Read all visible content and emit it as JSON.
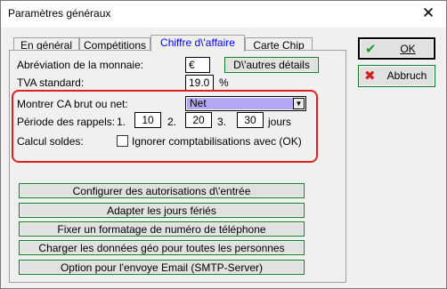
{
  "window": {
    "title": "Paramètres généraux",
    "close_glyph": "✕"
  },
  "tabs": [
    {
      "label": "En général",
      "active": false
    },
    {
      "label": "Compétitions",
      "active": false
    },
    {
      "label": "Chiffre d\\'affaire",
      "active": true
    },
    {
      "label": "Carte Chip",
      "active": false
    }
  ],
  "currency": {
    "label": "Abréviation de la monnaie:",
    "value": "€",
    "details_button": "D\\'autres détails"
  },
  "vat": {
    "label": "TVA standard:",
    "value": "19.0",
    "unit": "%"
  },
  "revenue": {
    "label": "Montrer CA brut ou net:",
    "selected": "Net"
  },
  "reminders": {
    "label": "Période des rappels:",
    "items": [
      {
        "num": "1.",
        "value": "10"
      },
      {
        "num": "2.",
        "value": "20"
      },
      {
        "num": "3.",
        "value": "30"
      }
    ],
    "unit": "jours"
  },
  "balance": {
    "label": "Calcul soldes:",
    "checkbox_label": "Ignorer comptabilisations avec (OK)",
    "checked": false
  },
  "action_buttons": [
    "Configurer des autorisations d\\'entrée",
    "Adapter les jours fériés",
    "Fixer un formatage de numéro de téléphone",
    "Charger les données géo pour toutes les personnes",
    "Option pour l'envoye Email (SMTP-Server)"
  ],
  "side_buttons": {
    "ok": {
      "label": "OK",
      "icon": "check-icon",
      "color": "#1a9a3a"
    },
    "cancel": {
      "label": "Abbruch",
      "icon": "cross-icon",
      "color": "#d02020"
    }
  },
  "colors": {
    "highlight": "#e02020",
    "select_highlight": "#b5a6f3",
    "active_tab_text": "#0000ff",
    "button_border": "#0d7d2b"
  }
}
